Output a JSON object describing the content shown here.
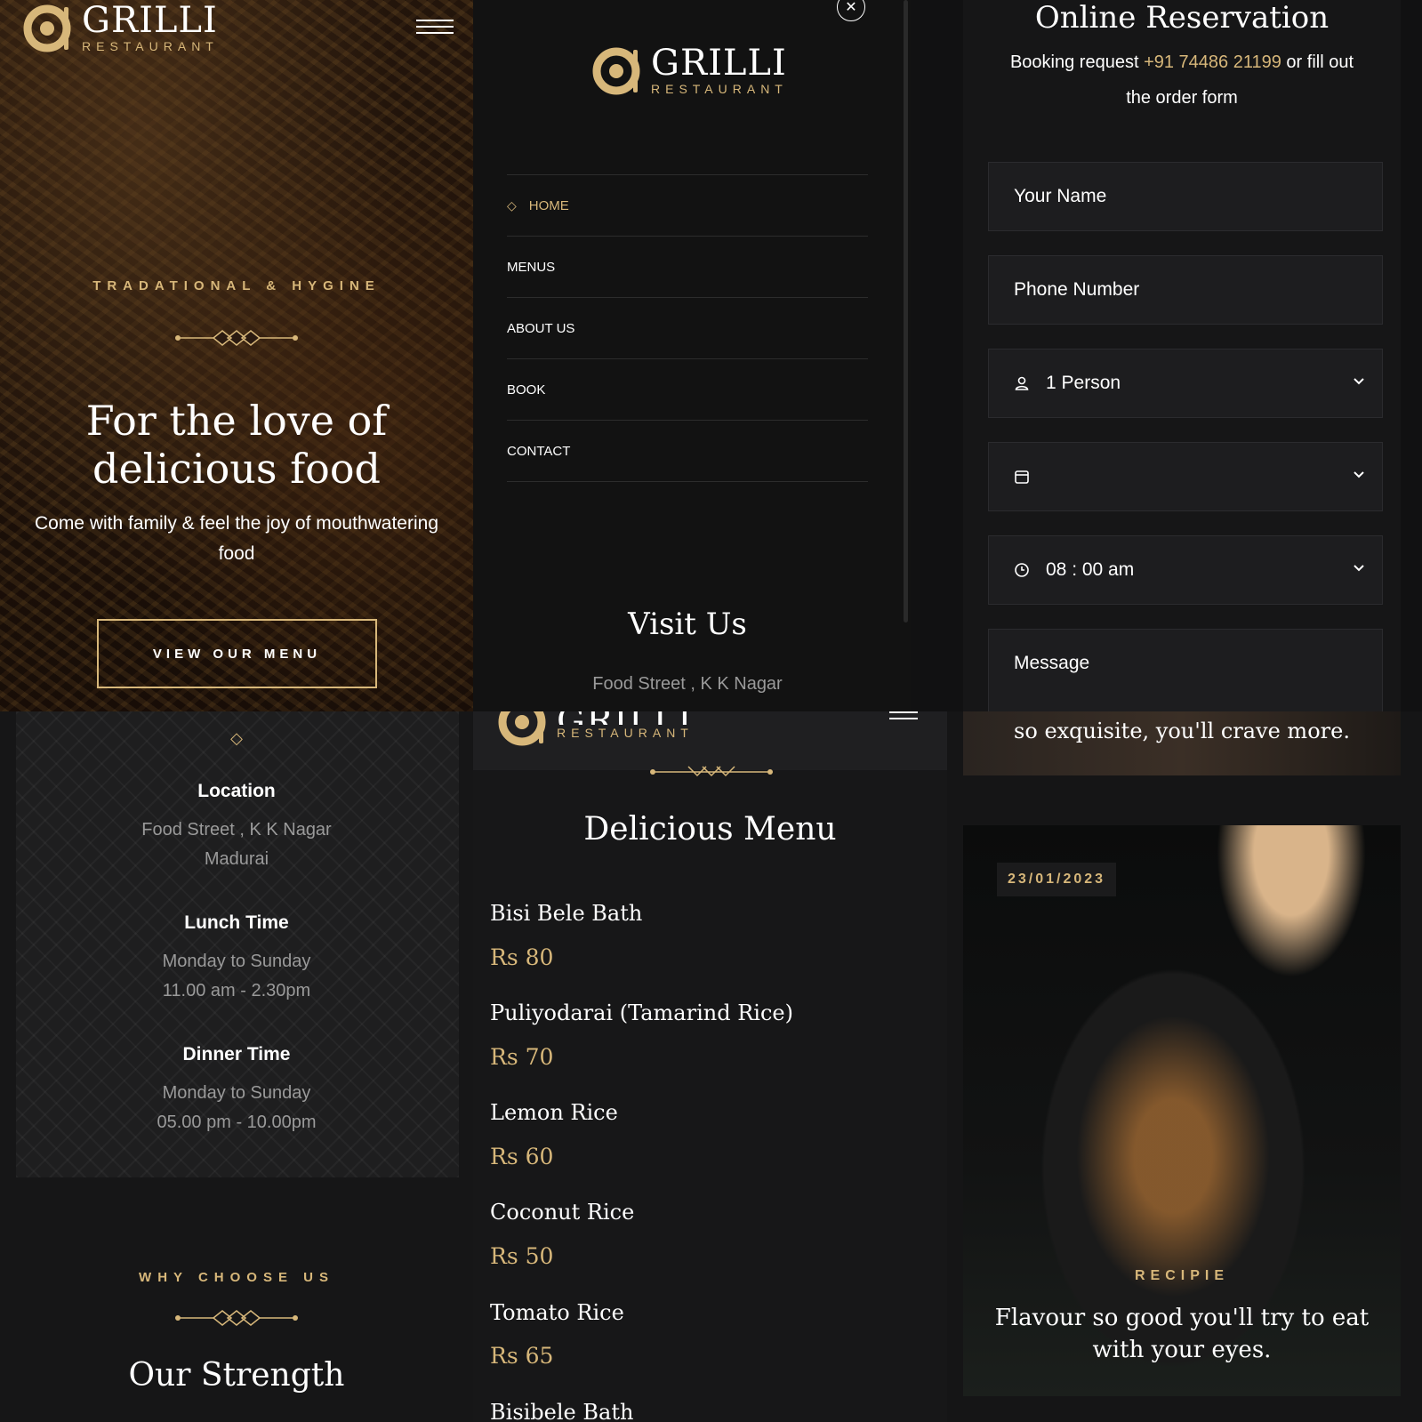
{
  "brand": {
    "name": "GRILLI",
    "tagline": "RESTAURANT"
  },
  "hero": {
    "eyebrow": "TRADATIONAL & HYGINE",
    "title_line1": "For the love of",
    "title_line2": "delicious food",
    "subtitle_line1": "Come with family & feel the joy of mouthwatering",
    "subtitle_line2": "food",
    "cta": "VIEW OUR MENU"
  },
  "mobile_menu": {
    "items": [
      {
        "label": "HOME",
        "active": true
      },
      {
        "label": "MENUS"
      },
      {
        "label": "ABOUT US"
      },
      {
        "label": "BOOK"
      },
      {
        "label": "CONTACT"
      }
    ],
    "visit_title": "Visit Us",
    "visit_address": "Food Street , K K Nagar"
  },
  "reservation": {
    "title": "Online Reservation",
    "intro_before": "Booking request ",
    "phone": "+91 74486 21199",
    "intro_after": " or fill out",
    "intro_line2": "the order form",
    "name_placeholder": "Your Name",
    "phone_placeholder": "Phone Number",
    "persons_value": "1 Person",
    "date_value": "",
    "time_value": "08 : 00 am",
    "message_placeholder": "Message"
  },
  "info": {
    "location_title": "Location",
    "location_line1": "Food Street , K K Nagar",
    "location_line2": "Madurai",
    "lunch_title": "Lunch Time",
    "lunch_line1": "Monday to Sunday",
    "lunch_line2": "11.00 am - 2.30pm",
    "dinner_title": "Dinner Time",
    "dinner_line1": "Monday to Sunday",
    "dinner_line2": "05.00 pm - 10.00pm",
    "why_eyebrow": "WHY CHOOSE US",
    "strength_title": "Our Strength"
  },
  "menu": {
    "title": "Delicious Menu",
    "items": [
      {
        "name": "Bisi Bele Bath",
        "price": "Rs 80"
      },
      {
        "name": "Puliyodarai (Tamarind Rice)",
        "price": "Rs 70"
      },
      {
        "name": "Lemon Rice",
        "price": "Rs 60"
      },
      {
        "name": "Coconut Rice",
        "price": "Rs 50"
      },
      {
        "name": "Tomato Rice",
        "price": "Rs 65"
      },
      {
        "name": "Bisibele Bath"
      }
    ]
  },
  "blog": {
    "top_text": "so exquisite, you'll crave more.",
    "date": "23/01/2023",
    "category": "RECIPIE",
    "title_line1": "Flavour so good you'll try to eat",
    "title_line2": "with your eyes."
  },
  "colors": {
    "accent": "#d7b77a",
    "background": "#111112"
  }
}
